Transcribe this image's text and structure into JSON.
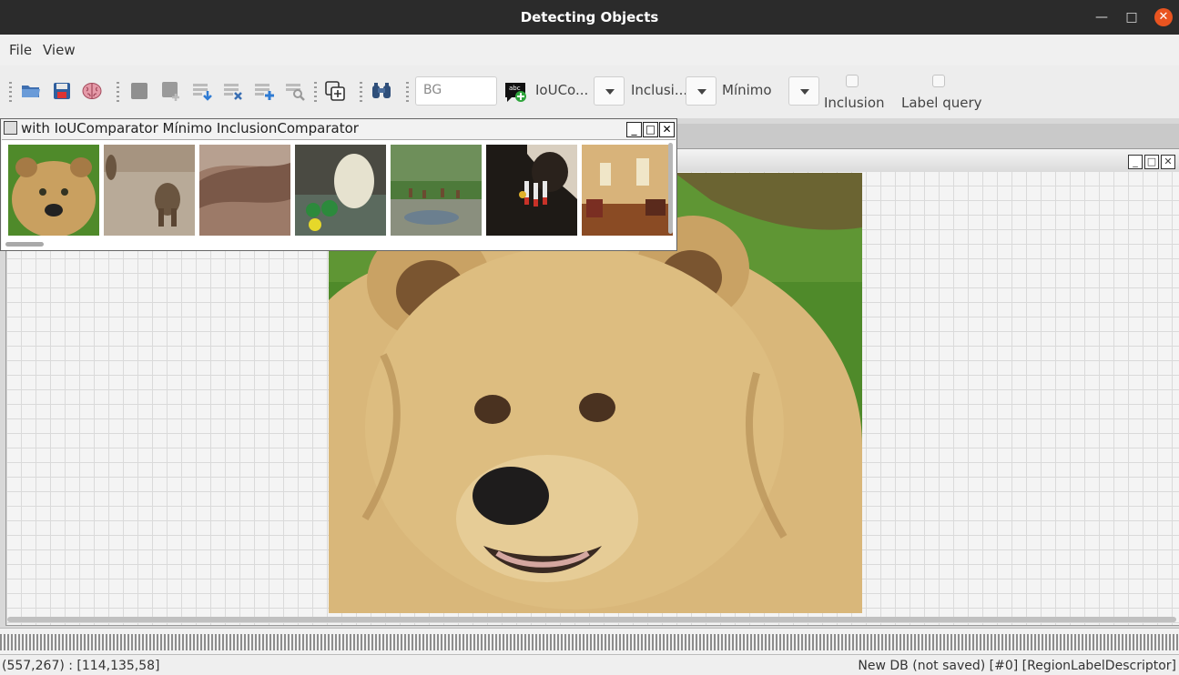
{
  "window": {
    "title": "Detecting Objects",
    "min_glyph": "—",
    "max_glyph": "□",
    "close_glyph": "✕"
  },
  "menu": {
    "items": [
      "File",
      "View"
    ]
  },
  "toolbar": {
    "icons": [
      "open-folder-icon",
      "save-icon",
      "brain-icon",
      "square-icon",
      "add-shape-icon",
      "import-icon",
      "delete-icon",
      "add-icon",
      "find-icon",
      "copy-add-icon",
      "binoculars-icon",
      "label-add-icon"
    ],
    "bg_field": "BG",
    "comparator1": "IoUCo...",
    "comparator2": "Inclusi...",
    "comparator3": "Mínimo",
    "checkbox1_label": "Inclusion",
    "checkbox2_label": "Label query"
  },
  "thumbnail_window": {
    "title": "with IoUComparator Mínimo InclusionComparator",
    "btn_min": "_",
    "btn_max": "□",
    "btn_close": "✕",
    "thumbnails": [
      "bear-face",
      "bear-walking",
      "fur-closeup",
      "polar-bear-pool",
      "deer-waterhole",
      "cow-milking",
      "living-room"
    ]
  },
  "subwindow": {
    "btn_min": "_",
    "btn_max": "□",
    "btn_close": "✕"
  },
  "status": {
    "left": "(557,267) : [114,135,58]",
    "right": "New DB (not saved) [#0] [RegionLabelDescriptor]"
  },
  "colors": {
    "titlebar": "#2b2b2b",
    "close_button": "#e95420",
    "grass": "#4f8a2a",
    "bear_fur": "#d9b77a"
  }
}
